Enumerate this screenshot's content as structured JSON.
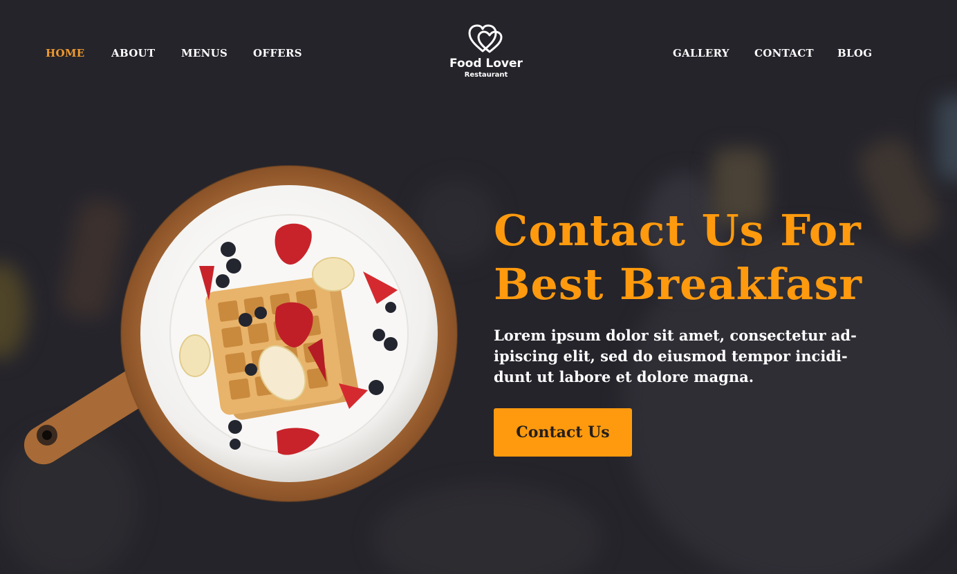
{
  "nav": {
    "left": [
      {
        "label": "HOME",
        "active": true
      },
      {
        "label": "ABOUT"
      },
      {
        "label": "MENUS"
      },
      {
        "label": "OFFERS"
      }
    ],
    "right": [
      {
        "label": "GALLERY"
      },
      {
        "label": "CONTACT"
      },
      {
        "label": "BLOG"
      }
    ]
  },
  "logo": {
    "name": "Food Lover",
    "subtitle": "Restaurant",
    "icon": "double-heart-icon"
  },
  "hero": {
    "title_lines": [
      "Contact Us For",
      "Best Breakfasr"
    ],
    "text_lines": [
      "Lorem ipsum dolor sit amet, consectetur ad-",
      "ipiscing elit, sed do eiusmod tempor incidi-",
      "dunt ut labore et dolore magna."
    ],
    "cta_label": "Contact Us"
  },
  "colors": {
    "background": "#25242b",
    "accent": "#ff9a0e",
    "nav_active": "#f29a2e",
    "text": "#ffffff"
  }
}
